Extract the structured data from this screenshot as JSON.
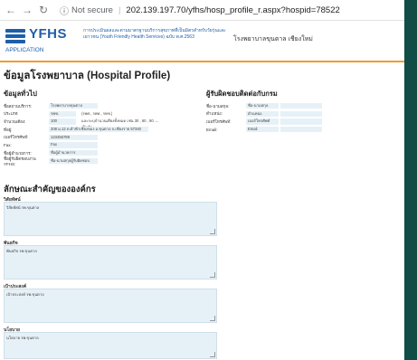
{
  "browser": {
    "security_label": "Not secure",
    "url": "202.139.197.70/yfhs/hosp_profile_r.aspx?hospid=78522"
  },
  "header": {
    "logo_text": "YFHS",
    "logo_sub": "APPLICATION",
    "tagline": "การประเมินผลและตามมาตรฐานบริการสุขภาพที่เป็นมิตรสำหรับวัยรุ่นและเยาวชน (Youth Friendly Health Services) ฉบับ พ.ศ.2563",
    "hospital_name": "โรงพยาบาลขุนตาล เชียงใหม่"
  },
  "page_title": "ข้อมูลโรงพยาบาล (Hospital Profile)",
  "general": {
    "heading": "ข้อมูลทั่วไป",
    "rows": [
      {
        "label": "ชื่อสถานบริการ:",
        "value": "โรงพยาบาลขุนตาล",
        "value2": ""
      },
      {
        "label": "ประเภท:",
        "value": "รพช.",
        "value2": "(รพศ., รพท., รพช.)"
      },
      {
        "label": "จำนวนเตียง:",
        "value": "100",
        "value2": "และระบุจำนวนเตียงทั้งหมด เช่น 30 , 60 , 90 .... เป็นต้น"
      },
      {
        "label": "ที่อยู่:",
        "value": "208 ม.12 ต.ต้าฟ้าเชียงของ อ.ขุนตาล จ.เชียงราย 57340",
        "value2": ""
      },
      {
        "label": "เบอร์โทรศัพท์:",
        "value": "123456789",
        "value2": ""
      },
      {
        "label": "Fax:",
        "value": "Fax",
        "value2": ""
      },
      {
        "label": "ชื่อผู้อำนวยการ:",
        "value": "ชื่อผู้อำนวยการ",
        "value2": ""
      },
      {
        "label": "ชื่อผู้รับผิดชอบงาน YFHS:",
        "value": "ชื่อ-นามสกุลผู้รับผิดชอบ",
        "value2": ""
      }
    ]
  },
  "contact": {
    "heading": "ผู้รับผิดชอบติดต่อกับกรม",
    "rows": [
      {
        "label": "ชื่อ-นามสกุล:",
        "value": "ชื่อ-นามสกุล"
      },
      {
        "label": "ตำแหน่ง:",
        "value": "ตำแหน่ง"
      },
      {
        "label": "เบอร์โทรศัพท์:",
        "value": "เบอร์โทรศัพท์"
      },
      {
        "label": "Email:",
        "value": "Email"
      }
    ]
  },
  "org": {
    "heading": "ลักษณะสำคัญขององค์กร",
    "fields": [
      {
        "label": "วิสัยทัศน์",
        "value": "วิสัยทัศน์ รพ.ขุนตาล"
      },
      {
        "label": "พันธกิจ",
        "value": "พันธกิจ รพ.ขุนตาล"
      },
      {
        "label": "เป้าประสงค์",
        "value": "เป้าประสงค์ รพ.ขุนตาล"
      },
      {
        "label": "นโยบาย",
        "value": "นโยบาย รพ.ขุนตาล"
      }
    ]
  }
}
